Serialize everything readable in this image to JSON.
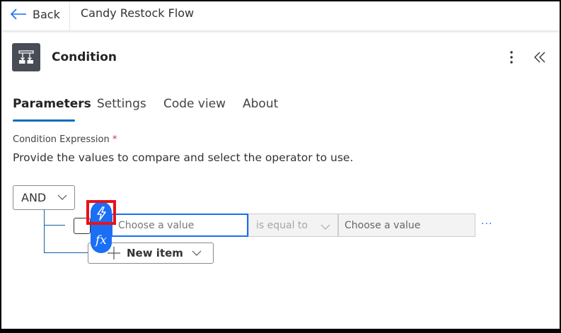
{
  "header": {
    "back_label": "Back",
    "flow_title": "Candy Restock Flow"
  },
  "panel": {
    "title": "Condition",
    "more_icon": "more-vertical-icon",
    "collapse_icon": "chevron-double-left-icon"
  },
  "tabs": [
    {
      "label": "Parameters",
      "active": true
    },
    {
      "label": "Settings"
    },
    {
      "label": "Code view"
    },
    {
      "label": "About"
    }
  ],
  "condition": {
    "label": "Condition Expression",
    "required_mark": "*",
    "description": "Provide the values to compare and select the operator to use.",
    "group_operator": "AND",
    "row": {
      "left_placeholder": "Choose a value",
      "operator": "is equal to",
      "right_placeholder": "Choose a value",
      "more": "···"
    },
    "new_item_label": "New item"
  },
  "colors": {
    "accent": "#0f6cbd",
    "pill": "#1a6ff4",
    "highlight": "#e8111b",
    "icon_bg": "#474c55"
  }
}
